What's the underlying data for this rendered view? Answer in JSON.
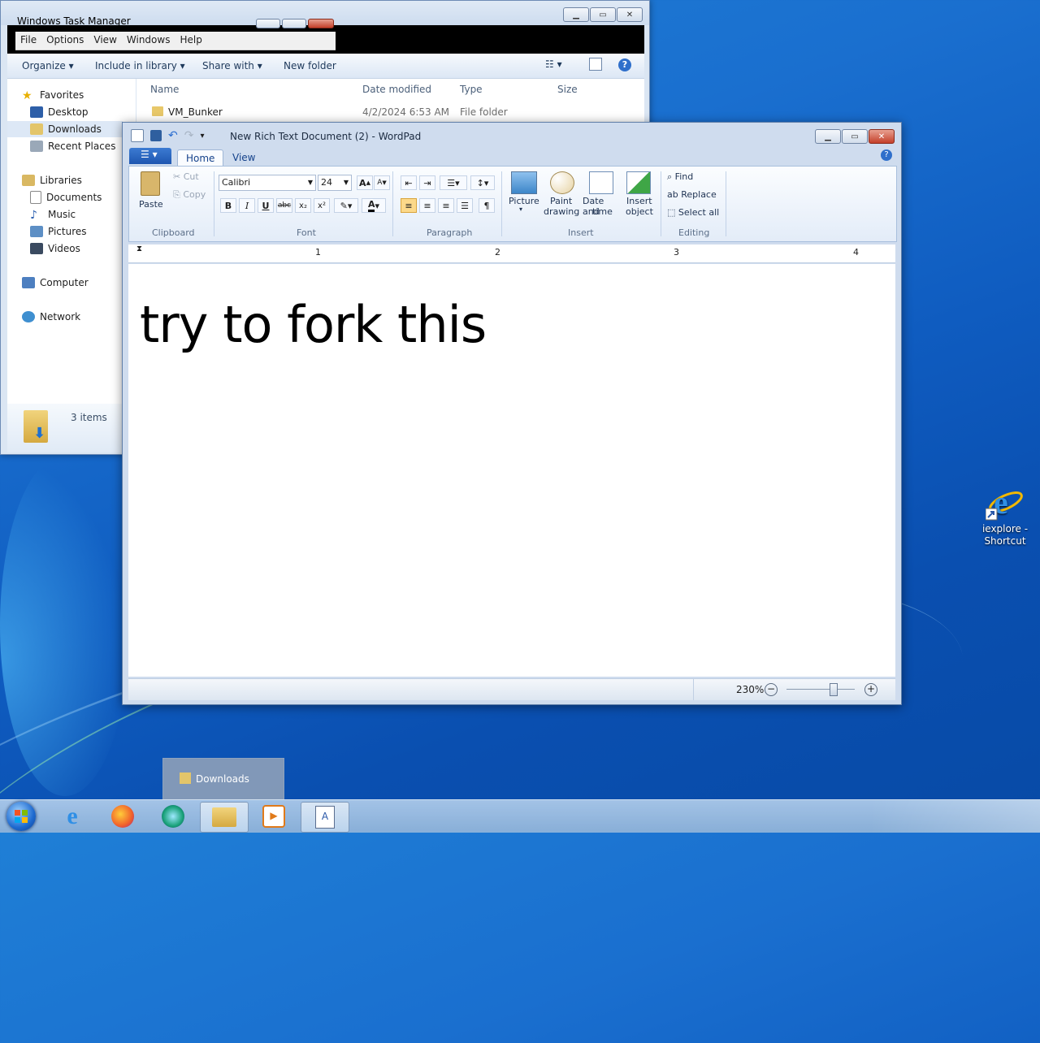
{
  "explorer": {
    "tm_title": "Windows Task Manager",
    "tm_menu": [
      "File",
      "Options",
      "View",
      "Windows",
      "Help"
    ],
    "commands": {
      "organize": "Organize",
      "include": "Include in library",
      "share": "Share with",
      "new_folder": "New folder"
    },
    "nav": {
      "favorites": "Favorites",
      "desktop": "Desktop",
      "downloads": "Downloads",
      "recent": "Recent Places",
      "libraries": "Libraries",
      "documents": "Documents",
      "music": "Music",
      "pictures": "Pictures",
      "videos": "Videos",
      "computer": "Computer",
      "network": "Network"
    },
    "columns": {
      "name": "Name",
      "date": "Date modified",
      "type": "Type",
      "size": "Size"
    },
    "files": [
      {
        "name": "VM_Bunker",
        "date": "4/2/2024 6:53 AM",
        "type": "File folder"
      }
    ],
    "item_count": "3 items"
  },
  "wordpad": {
    "title": "New Rich Text Document (2) - WordPad",
    "tabs": {
      "home": "Home",
      "view": "View"
    },
    "clipboard": {
      "paste": "Paste",
      "cut": "Cut",
      "copy": "Copy",
      "group": "Clipboard"
    },
    "font": {
      "family": "Calibri",
      "size": "24",
      "group": "Font"
    },
    "paragraph": {
      "group": "Paragraph"
    },
    "insert": {
      "picture": "Picture",
      "paint1": "Paint",
      "paint2": "drawing",
      "date1": "Date and",
      "date2": "time",
      "obj1": "Insert",
      "obj2": "object",
      "group": "Insert"
    },
    "editing": {
      "find": "Find",
      "replace": "Replace",
      "select_all": "Select all",
      "group": "Editing"
    },
    "ruler": [
      "1",
      "2",
      "3",
      "4"
    ],
    "document_text": "try to fork this",
    "zoom": "230%",
    "zoom_level_fraction": 0.68
  },
  "desktop": {
    "ie_label1": "iexplore -",
    "ie_label2": "Shortcut"
  },
  "taskbar": {
    "thumb_label": "Downloads"
  }
}
